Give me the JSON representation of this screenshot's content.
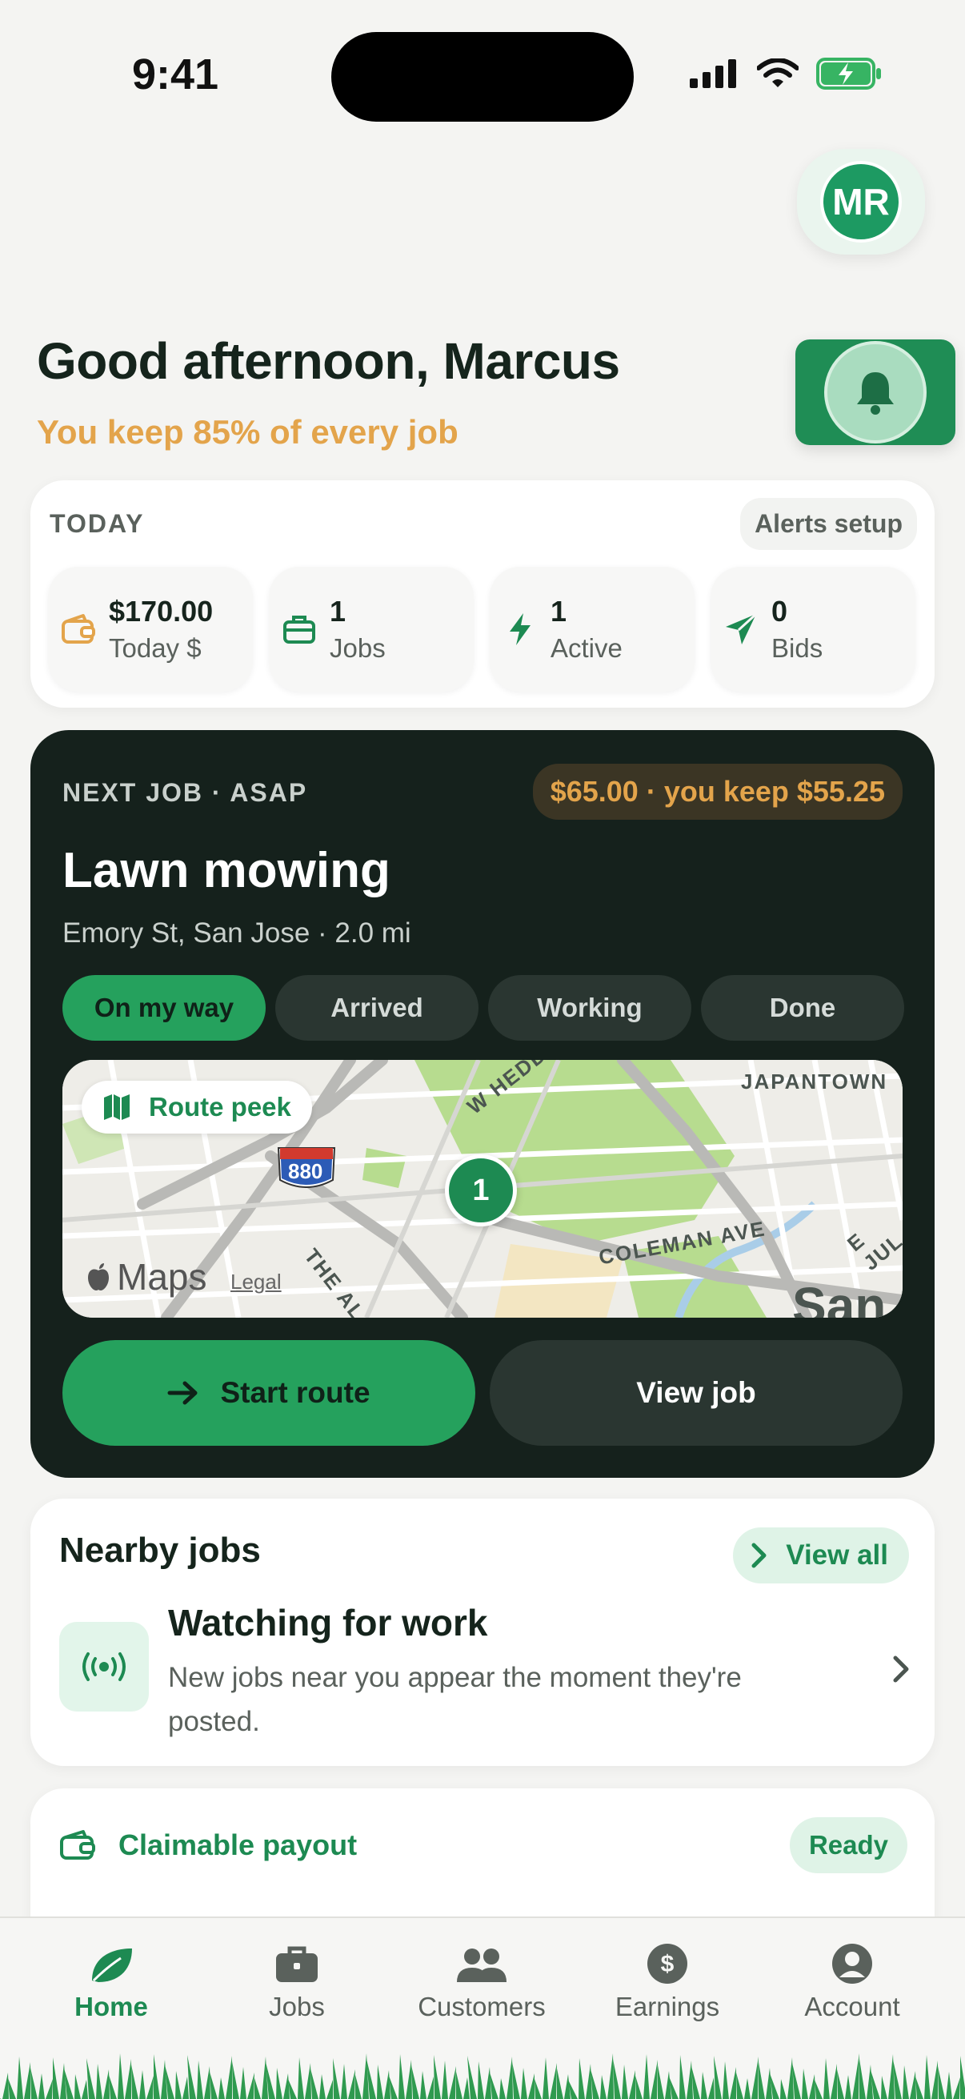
{
  "status_bar": {
    "time": "9:41"
  },
  "avatar": {
    "initials": "MR"
  },
  "greeting": {
    "title": "Good afternoon, Marcus",
    "subtitle": "You keep 85% of every job"
  },
  "today": {
    "label": "TODAY",
    "alerts_setup": "Alerts setup",
    "stats": [
      {
        "value": "$170.00",
        "label": "Today $",
        "icon": "wallet-icon"
      },
      {
        "value": "1",
        "label": "Jobs",
        "icon": "briefcase-icon"
      },
      {
        "value": "1",
        "label": "Active",
        "icon": "bolt-icon"
      },
      {
        "value": "0",
        "label": "Bids",
        "icon": "send-icon"
      }
    ]
  },
  "next_job": {
    "label": "NEXT JOB · ASAP",
    "price": "$65.00 · you keep $55.25",
    "title": "Lawn mowing",
    "address": "Emory St, San Jose · 2.0 mi",
    "steps": [
      "On my way",
      "Arrived",
      "Working",
      "Done"
    ],
    "active_step": "On my way",
    "map": {
      "route_peek": "Route peek",
      "marker": "1",
      "highway": "880",
      "brand": "Maps",
      "legal": "Legal",
      "labels": {
        "japantown": "JAPANTOWN",
        "w_hedding": "W HEDDIN",
        "coleman": "COLEMAN AVE",
        "alameda": "THE ALAM",
        "e_jul": "E JUL",
        "san": "San"
      }
    },
    "start_route": "Start route",
    "view_job": "View job"
  },
  "nearby": {
    "title": "Nearby jobs",
    "view_all": "View all",
    "watch_title": "Watching for work",
    "watch_sub": "New jobs near you appear the moment they're posted."
  },
  "claimable": {
    "title": "Claimable payout",
    "status": "Ready"
  },
  "tabs": [
    {
      "label": "Home",
      "icon": "leaf-icon"
    },
    {
      "label": "Jobs",
      "icon": "briefcase-icon"
    },
    {
      "label": "Customers",
      "icon": "people-icon"
    },
    {
      "label": "Earnings",
      "icon": "dollar-icon"
    },
    {
      "label": "Account",
      "icon": "person-icon"
    }
  ],
  "active_tab": "Home",
  "colors": {
    "brand_green": "#1d8a52",
    "accent_gold": "#e3a44b",
    "dark_card": "#15211c"
  }
}
